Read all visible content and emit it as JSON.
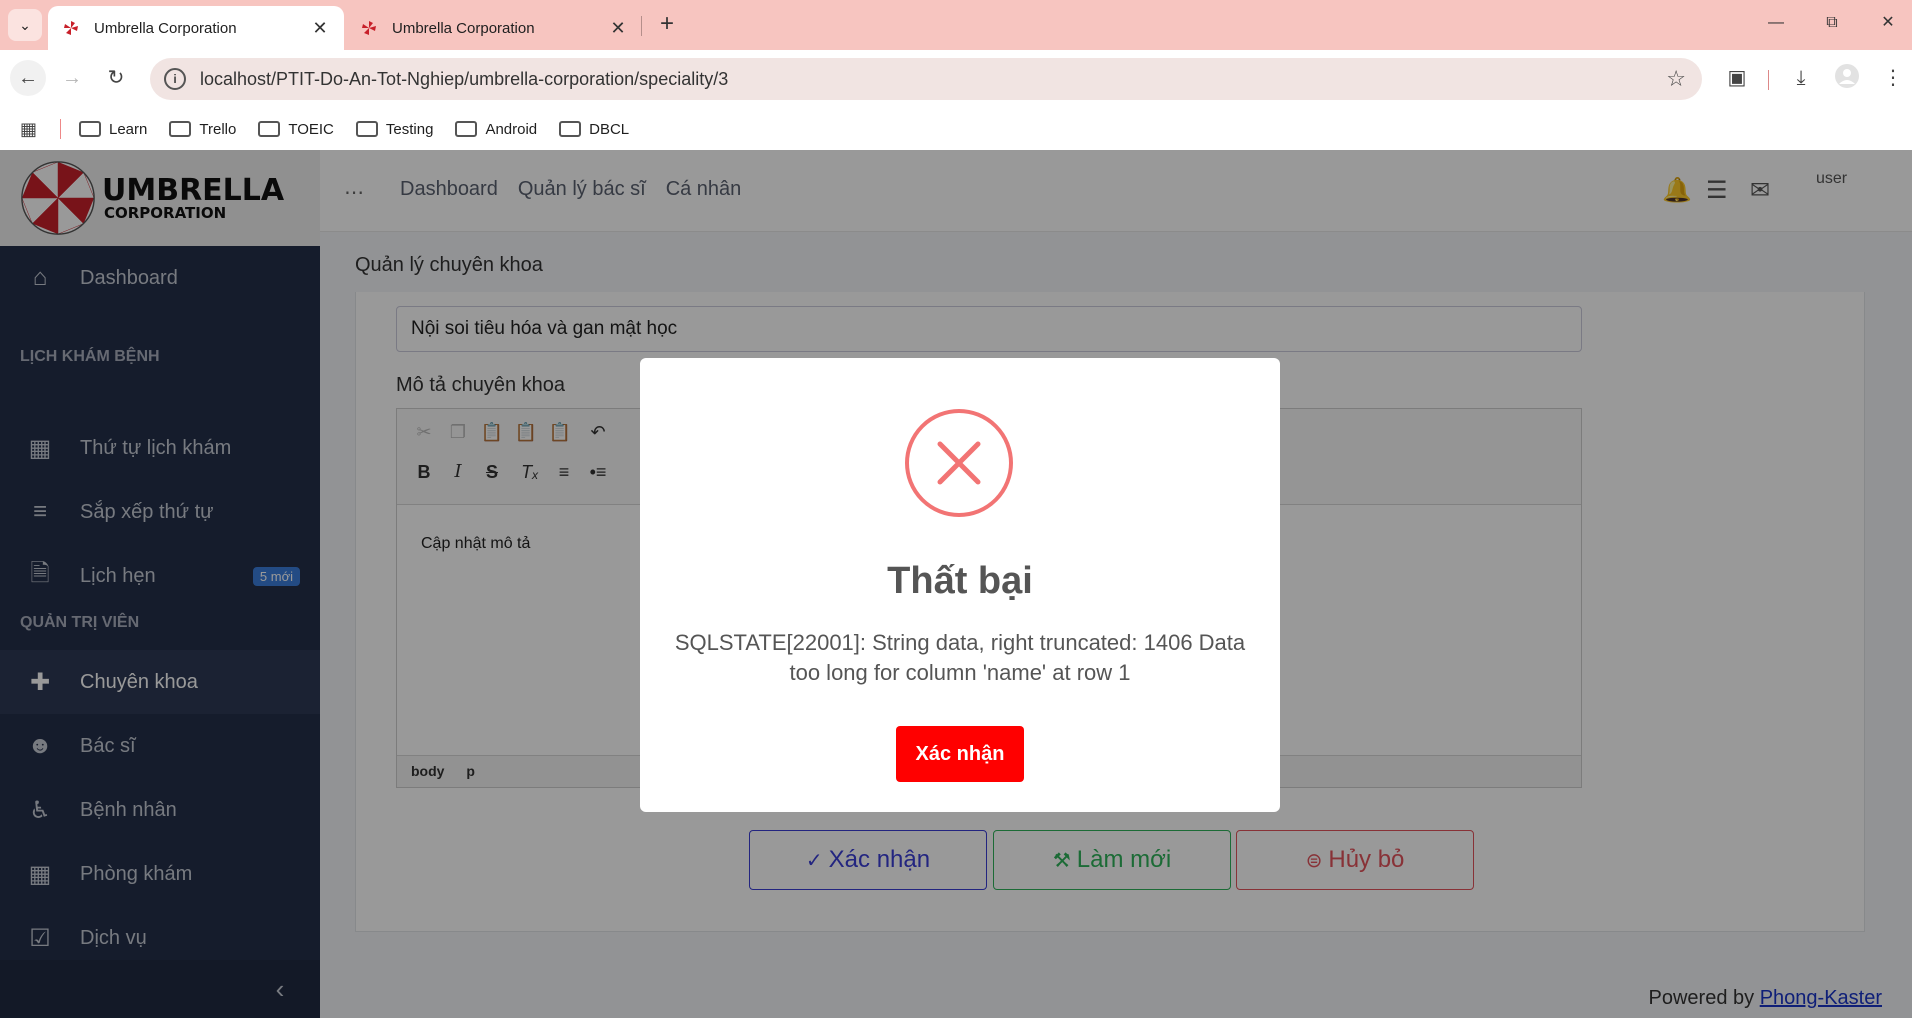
{
  "browser": {
    "tabs": [
      {
        "title": "Umbrella Corporation",
        "active": true
      },
      {
        "title": "Umbrella Corporation",
        "active": false
      }
    ],
    "url": "localhost/PTIT-Do-An-Tot-Nghiep/umbrella-corporation/speciality/3",
    "bookmarks": [
      "Learn",
      "Trello",
      "TOEIC",
      "Testing",
      "Android",
      "DBCL"
    ]
  },
  "brand": {
    "line1": "UMBRELLA",
    "line2": "CORPORATION",
    "logo_colors": [
      "#c8202a",
      "#ffffff"
    ]
  },
  "sidebar": {
    "dashboard": "Dashboard",
    "section1": "LỊCH KHÁM BỆNH",
    "items1": [
      {
        "label": "Thứ tự lịch khám",
        "icon": "calendar-icon"
      },
      {
        "label": "Sắp xếp thứ tự",
        "icon": "sort-lines-icon"
      },
      {
        "label": "Lịch hẹn",
        "icon": "document-icon",
        "badge": "5 mới"
      }
    ],
    "section2": "QUẢN TRỊ VIÊN",
    "items2": [
      {
        "label": "Chuyên khoa",
        "icon": "plus-icon",
        "active": true
      },
      {
        "label": "Bác sĩ",
        "icon": "users-icon"
      },
      {
        "label": "Bệnh nhân",
        "icon": "wheelchair-icon"
      },
      {
        "label": "Phòng khám",
        "icon": "building-icon"
      },
      {
        "label": "Dịch vụ",
        "icon": "checkbox-icon"
      }
    ],
    "collapse_icon": "chevron-left-icon"
  },
  "topnav": {
    "links": [
      "Dashboard",
      "Quản lý bác sĩ",
      "Cá nhân"
    ],
    "user_alt": "user"
  },
  "content": {
    "breadcrumb": "Quản lý chuyên khoa",
    "name_value": "Nội soi tiêu hóa và gan mật học",
    "desc_label": "Mô tả chuyên khoa",
    "editor_text": "Cập nhật mô tả",
    "editor_path": [
      "body",
      "p"
    ],
    "buttons": {
      "confirm": "Xác nhận",
      "reset": "Làm mới",
      "cancel": "Hủy bỏ"
    }
  },
  "footer": {
    "prefix": "Powered by",
    "link": "Phong-Kaster"
  },
  "modal": {
    "title": "Thất bại",
    "message": "SQLSTATE[22001]: String data, right truncated: 1406 Data too long for column 'name' at row 1",
    "button": "Xác nhận",
    "icon": "error-x-icon",
    "icon_color": "#f27474"
  }
}
